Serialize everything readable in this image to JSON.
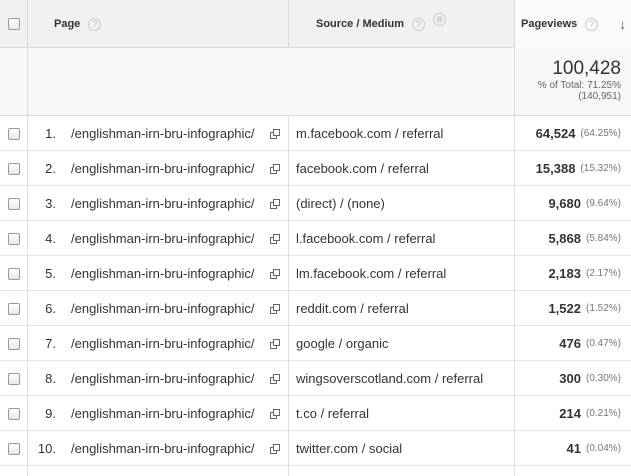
{
  "header": {
    "page": "Page",
    "source_medium": "Source / Medium",
    "pageviews": "Pageviews",
    "help_glyph": "?",
    "remove_glyph": "⊗",
    "sort_glyph": "↓"
  },
  "totals": {
    "pageviews": "100,428",
    "pct_line": "% of Total: 71.25%",
    "total_line": "(140,951)"
  },
  "rows": [
    {
      "index": "1.",
      "page": "/englishman-irn-bru-infographic/",
      "source": "m.facebook.com / referral",
      "pageviews": "64,524",
      "pct": "(64.25%)"
    },
    {
      "index": "2.",
      "page": "/englishman-irn-bru-infographic/",
      "source": "facebook.com / referral",
      "pageviews": "15,388",
      "pct": "(15.32%)"
    },
    {
      "index": "3.",
      "page": "/englishman-irn-bru-infographic/",
      "source": "(direct) / (none)",
      "pageviews": "9,680",
      "pct": "(9.64%)"
    },
    {
      "index": "4.",
      "page": "/englishman-irn-bru-infographic/",
      "source": "l.facebook.com / referral",
      "pageviews": "5,868",
      "pct": "(5.84%)"
    },
    {
      "index": "5.",
      "page": "/englishman-irn-bru-infographic/",
      "source": "lm.facebook.com / referral",
      "pageviews": "2,183",
      "pct": "(2.17%)"
    },
    {
      "index": "6.",
      "page": "/englishman-irn-bru-infographic/",
      "source": "reddit.com / referral",
      "pageviews": "1,522",
      "pct": "(1.52%)"
    },
    {
      "index": "7.",
      "page": "/englishman-irn-bru-infographic/",
      "source": "google / organic",
      "pageviews": "476",
      "pct": "(0.47%)"
    },
    {
      "index": "8.",
      "page": "/englishman-irn-bru-infographic/",
      "source": "wingsoverscotland.com / referral",
      "pageviews": "300",
      "pct": "(0.30%)"
    },
    {
      "index": "9.",
      "page": "/englishman-irn-bru-infographic/",
      "source": "t.co / referral",
      "pageviews": "214",
      "pct": "(0.21%)"
    },
    {
      "index": "10.",
      "page": "/englishman-irn-bru-infographic/",
      "source": "twitter.com / social",
      "pageviews": "41",
      "pct": "(0.04%)"
    }
  ],
  "icons": {
    "checkbox": "checkbox-icon",
    "open_link": "open-in-new-window-icon",
    "help": "help-icon",
    "remove": "remove-dimension-icon",
    "sort": "sort-descending-icon"
  }
}
